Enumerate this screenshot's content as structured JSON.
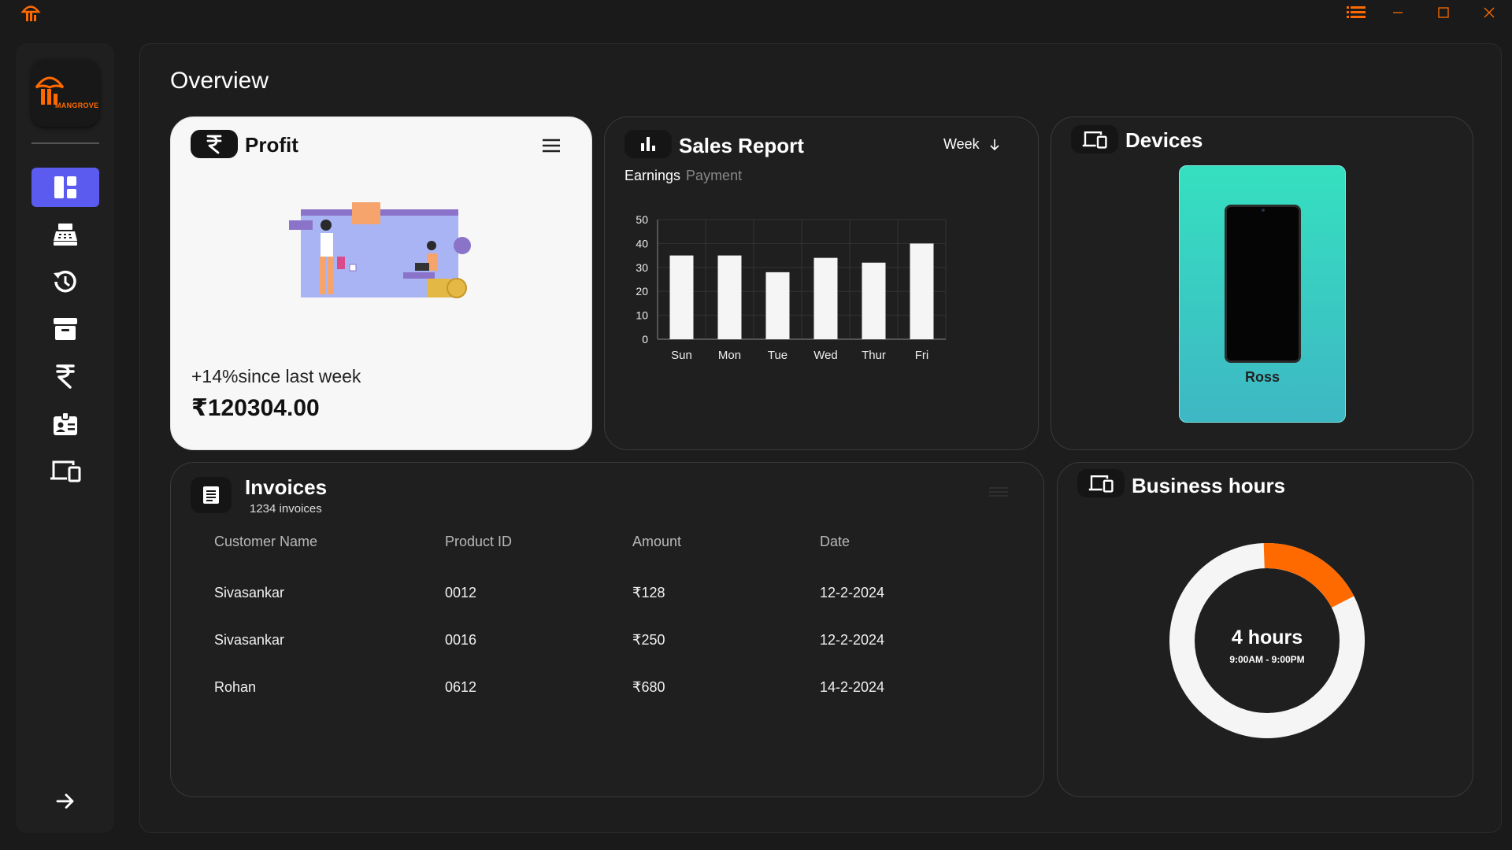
{
  "window": {
    "logo_icon": "mangrove-logo-icon",
    "menu_icon": "list-icon",
    "minimize_icon": "minimize-icon",
    "maximize_icon": "maximize-icon",
    "close_icon": "close-icon"
  },
  "sidebar": {
    "brand": "MANGROVE",
    "items": [
      {
        "icon": "dashboard-icon",
        "active": true
      },
      {
        "icon": "cash-register-icon",
        "active": false
      },
      {
        "icon": "history-icon",
        "active": false
      },
      {
        "icon": "archive-icon",
        "active": false
      },
      {
        "icon": "rupee-icon",
        "active": false
      },
      {
        "icon": "id-badge-icon",
        "active": false
      },
      {
        "icon": "devices-icon",
        "active": false
      }
    ],
    "expand_icon": "arrow-right-icon"
  },
  "page": {
    "title": "Overview"
  },
  "profit": {
    "title": "Profit",
    "icon": "rupee-icon",
    "growth": "+14%since last week",
    "amount": "₹120304.00"
  },
  "sales": {
    "title": "Sales Report",
    "period": "Week",
    "tabs": [
      "Earnings",
      "Payment"
    ],
    "active_tab": "Earnings"
  },
  "chart_data": {
    "type": "bar",
    "categories": [
      "Sun",
      "Mon",
      "Tue",
      "Wed",
      "Thur",
      "Fri"
    ],
    "values": [
      35,
      35,
      28,
      34,
      32,
      40
    ],
    "yticks": [
      0,
      10,
      20,
      30,
      40,
      50
    ],
    "ylim": [
      0,
      50
    ],
    "grid": true,
    "bar_color": "#f5f5f5"
  },
  "devices": {
    "title": "Devices",
    "items": [
      {
        "name": "Ross"
      }
    ]
  },
  "invoices": {
    "title": "Invoices",
    "count": "1234 invoices",
    "columns": [
      "Customer Name",
      "Product ID",
      "Amount",
      "Date"
    ],
    "rows": [
      [
        "Sivasankar",
        "0012",
        "₹128",
        "12-2-2024"
      ],
      [
        "Sivasankar",
        "0016",
        "₹250",
        "12-2-2024"
      ],
      [
        "Rohan",
        "0612",
        "₹680",
        "14-2-2024"
      ]
    ]
  },
  "hours": {
    "title": "Business hours",
    "value": "4 hours",
    "range": "9:00AM - 9:00PM",
    "progress": 0.18,
    "accent": "#ff6a00",
    "track": "#f5f5f5"
  }
}
